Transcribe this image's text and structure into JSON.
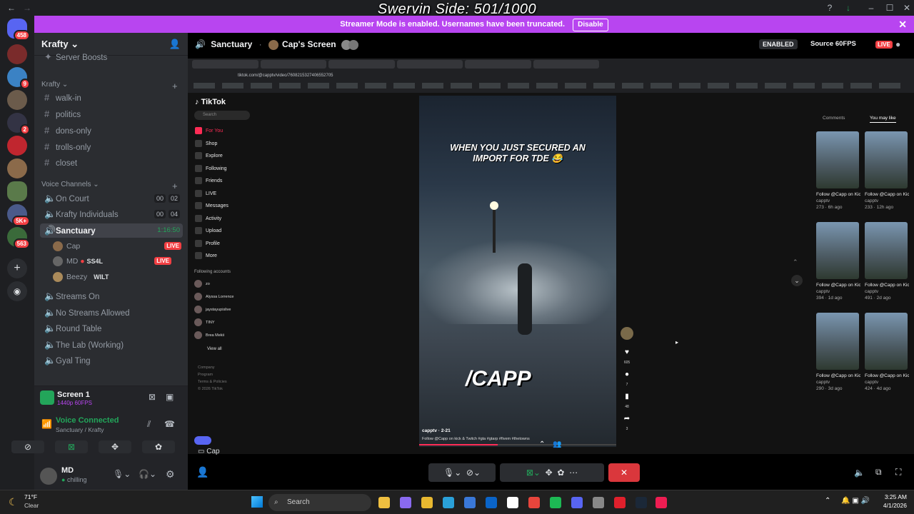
{
  "overlay": {
    "title": "Swervin Side: 501/1000"
  },
  "window": {
    "title": "Discord"
  },
  "banner": {
    "text": "Streamer Mode is enabled. Usernames have been truncated.",
    "disable_label": "Disable"
  },
  "server_badges": {
    "top": "458",
    "b1": "9",
    "b2": "2",
    "b3": "5K+",
    "b4": "563"
  },
  "guild": {
    "name": "Krafty",
    "server_boosts": "Server Boosts",
    "category": "Krafty",
    "voice_category": "Voice Channels"
  },
  "text_channels": [
    "walk-in",
    "politics",
    "dons-only",
    "trolls-only",
    "closet"
  ],
  "voice_channels": [
    {
      "name": "On Court",
      "c1": "00",
      "c2": "02"
    },
    {
      "name": "Krafty Individuals",
      "c1": "00",
      "c2": "04"
    },
    {
      "name": "Sanctuary",
      "timer": "1:16:50"
    }
  ],
  "sanctuary_users": [
    {
      "name": "Cap",
      "status": "LIVE"
    },
    {
      "name": "MD",
      "tag": "SS4L",
      "status": "LIVE"
    },
    {
      "name": "Beezy",
      "tag": "WILT"
    }
  ],
  "more_voice": [
    "Streams On",
    "No Streams Allowed",
    "Round Table",
    "The Lab (Working)",
    "Gyal Ting"
  ],
  "screen_panel": {
    "title": "Screen 1",
    "quality": "1440p 60FPS"
  },
  "voice_status": {
    "label": "Voice Connected",
    "location": "Sanctuary / Krafty"
  },
  "me": {
    "name": "MD",
    "status": "chilling"
  },
  "stream_header": {
    "channel": "Sanctuary",
    "screen": "Cap's Screen",
    "enabled": "ENABLED",
    "source": "Source 60FPS",
    "live": "LIVE"
  },
  "browser": {
    "url": "tiktok.com/@capptv/video/7608215327406552705"
  },
  "tiktok": {
    "brand": "TikTok",
    "search_placeholder": "Search",
    "nav": [
      "For You",
      "Shop",
      "Explore",
      "Following",
      "Friends",
      "LIVE",
      "Messages",
      "Activity",
      "Upload",
      "Profile",
      "More"
    ],
    "following_header": "Following accounts",
    "following": [
      "zo",
      "Alyssa Lorrence",
      "jaystayupislive",
      "TINY",
      "Brea Mekii"
    ],
    "view_all": "View all",
    "footer": [
      "Company",
      "Program",
      "Terms & Policies",
      "© 2026 TikTok"
    ],
    "caption": "WHEN YOU JUST SECURED AN IMPORT FOR TDE 😂",
    "watermark": "/CAPP",
    "author": "capptv · 2-21",
    "desc": "Follow @Capp on kick & Twitch #gta #gtarp #fivem #thetowns",
    "actions": {
      "likes": "605",
      "comments": "7",
      "saves": "48",
      "shares": "3"
    },
    "tabs": [
      "Comments",
      "You may like"
    ],
    "recs": [
      {
        "title": "Follow @Capp on Kick & Twitch...",
        "author": "capptv",
        "meta": "273 · 6h ago"
      },
      {
        "title": "Follow @Capp on Kick & Twitch...",
        "author": "capptv",
        "meta": "233 · 12h ago"
      },
      {
        "title": "Follow @Capp on Kick & Twitch...",
        "author": "capptv",
        "meta": "394 · 1d ago"
      },
      {
        "title": "Follow @Capp on Kick & Twitch...",
        "author": "capptv",
        "meta": "491 · 2d ago"
      },
      {
        "title": "Follow @Capp on Kick & Twitch...",
        "author": "capptv",
        "meta": "290 · 3d ago"
      },
      {
        "title": "Follow @Capp on Kick & Twitch...",
        "author": "capptv",
        "meta": "424 · 4d ago"
      }
    ]
  },
  "stream_footer": {
    "user": "Cap"
  },
  "weather": {
    "temp": "71°F",
    "cond": "Clear"
  },
  "taskbar": {
    "search": "Search",
    "time": "3:25 AM",
    "date": "4/1/2026"
  },
  "colors": {
    "accent": "#b845f0",
    "live": "#f23f43",
    "green": "#23a55a",
    "end_call": "#da373c"
  }
}
